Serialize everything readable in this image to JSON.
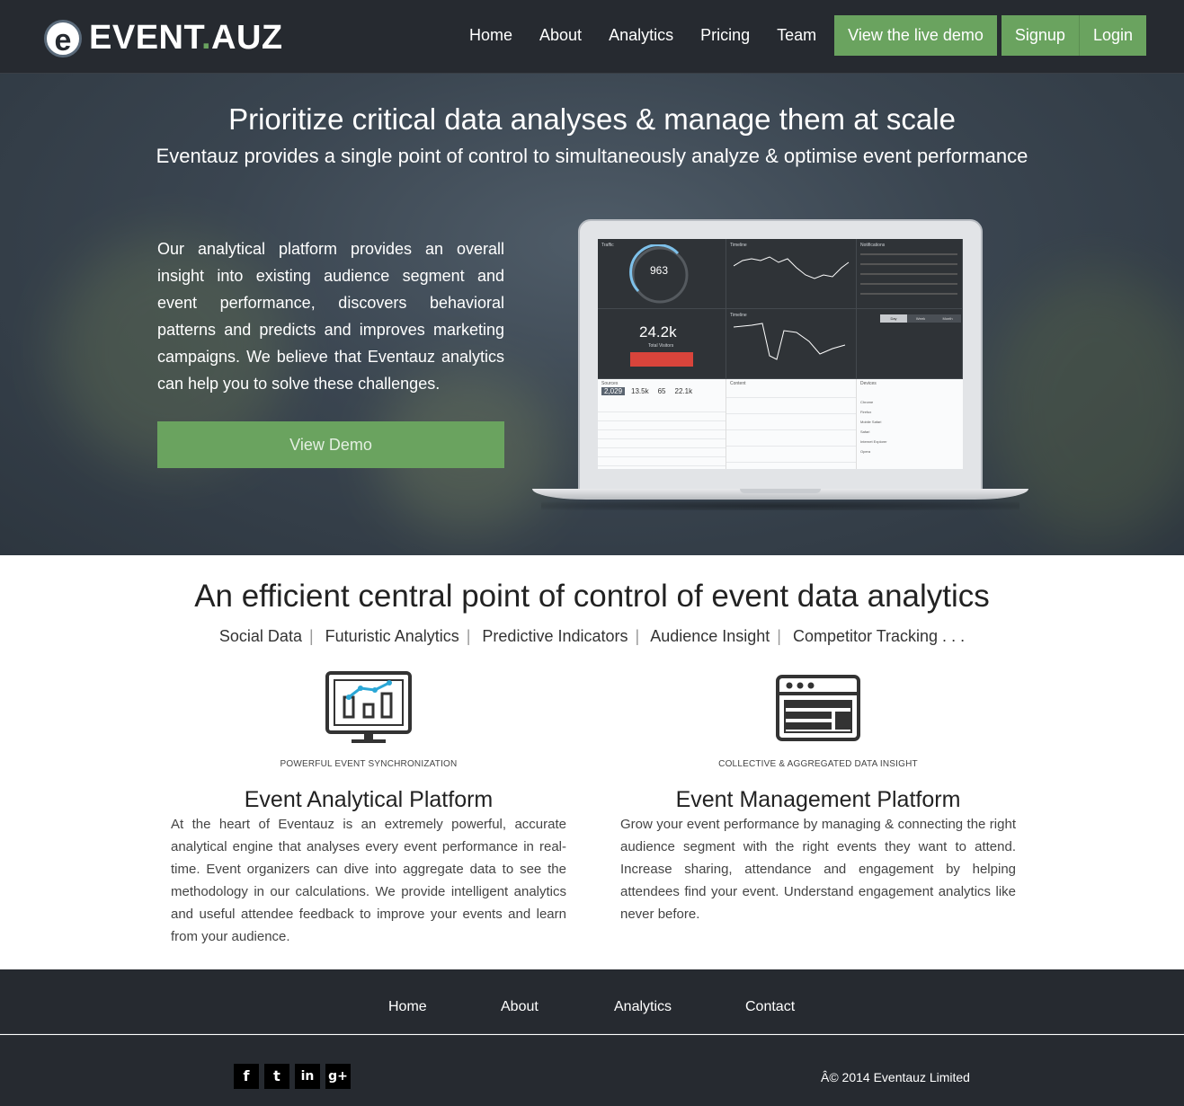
{
  "brand": {
    "logo_letter": "e",
    "name_part1": "EVENT",
    "name_dot": ".",
    "name_part2": "AUZ"
  },
  "nav": {
    "links": [
      "Home",
      "About",
      "Analytics",
      "Pricing",
      "Team"
    ],
    "demo_button": "View the live demo",
    "signup_button": "Signup",
    "login_button": "Login"
  },
  "hero": {
    "title": "Prioritize critical data analyses & manage them at scale",
    "subtitle": "Eventauz provides a single point of control to simultaneously analyze & optimise event performance",
    "description": "Our analytical platform provides an overall insight into existing audience segment and event performance, discovers behavioral patterns and predicts and improves marketing campaigns. We believe that Eventauz analytics can help you to solve these challenges.",
    "cta": "View Demo"
  },
  "dashboard": {
    "traffic_label": "Traffic",
    "traffic_value": "963",
    "timeline_label": "Timeline",
    "notifications_label": "Notifications",
    "visitors_value": "24.2k",
    "visitors_label": "Total Visitors",
    "tabs": [
      "Day",
      "Week",
      "Month"
    ],
    "sources_label": "Sources",
    "stats": [
      "2,029",
      "13.5k",
      "65",
      "22.1k"
    ],
    "content_label": "Content",
    "devices_label": "Devices",
    "browsers": [
      "Chrome",
      "Firefox",
      "Mobile Safari",
      "Safari",
      "Internet Explorer",
      "Opera"
    ]
  },
  "features": {
    "title": "An efficient central point of control of event data analytics",
    "tags": [
      "Social Data",
      "Futuristic Analytics",
      "Predictive Indicators",
      "Audience Insight",
      "Competitor Tracking . . ."
    ],
    "left": {
      "caption": "POWERFUL EVENT SYNCHRONIZATION",
      "heading": "Event Analytical Platform",
      "body": "At the heart of Eventauz is an extremely powerful, accurate analytical engine that analyses every event performance in real-time. Event organizers can dive into aggregate data to see the methodology in our calculations. We provide intelligent analytics and useful attendee feedback to improve your events and learn from your audience."
    },
    "right": {
      "caption": "COLLECTIVE & AGGREGATED DATA INSIGHT",
      "heading": "Event Management Platform",
      "body": "Grow your event performance by managing & connecting the right audience segment with the right events they want to attend. Increase sharing, attendance and engagement by helping attendees find your event. Understand engagement analytics like never before."
    }
  },
  "footer": {
    "links": [
      "Home",
      "About",
      "Analytics",
      "Contact"
    ],
    "social": [
      "f",
      "t",
      "in",
      "g+"
    ],
    "copyright": "Â© 2014 Eventauz Limited"
  },
  "colors": {
    "accent": "#6aa35f",
    "dark": "#262a30"
  }
}
